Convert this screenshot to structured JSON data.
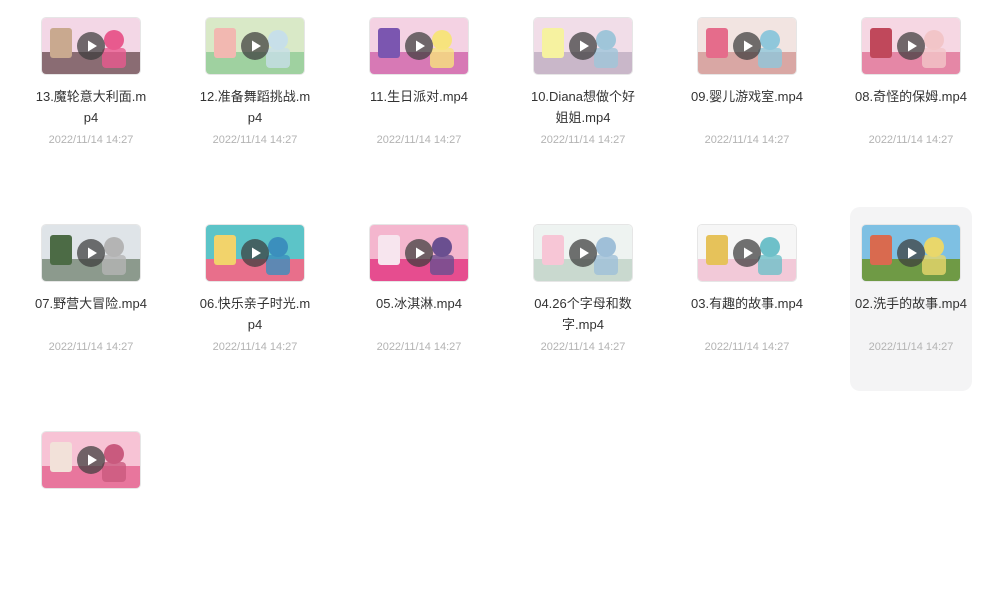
{
  "files": [
    {
      "name": "13.魔轮意大利面.mp4",
      "date": "2022/11/14 14:27",
      "selected": false,
      "colors": [
        "#f3d7e6",
        "#8a6c73",
        "#c9a98f",
        "#e85a8e"
      ]
    },
    {
      "name": "12.准备舞蹈挑战.mp4",
      "date": "2022/11/14 14:27",
      "selected": false,
      "colors": [
        "#d9e9c7",
        "#9fd1a0",
        "#f2b8b1",
        "#c7dfe9"
      ]
    },
    {
      "name": "11.生日派对.mp4",
      "date": "2022/11/14 14:27",
      "selected": false,
      "colors": [
        "#f4d2e3",
        "#d779b5",
        "#7b56b0",
        "#f7e37d"
      ]
    },
    {
      "name": "10.Diana想做个好姐姐.mp4",
      "date": "2022/11/14 14:27",
      "selected": false,
      "colors": [
        "#f1dde8",
        "#c9b7c9",
        "#f6f2a0",
        "#9fc5d9"
      ]
    },
    {
      "name": "09.婴儿游戏室.mp4",
      "date": "2022/11/14 14:27",
      "selected": false,
      "colors": [
        "#f2e4e1",
        "#d9a7a4",
        "#e56c8b",
        "#8fc7db"
      ]
    },
    {
      "name": "08.奇怪的保姆.mp4",
      "date": "2022/11/14 14:27",
      "selected": false,
      "colors": [
        "#f6d7e3",
        "#e587a6",
        "#c0485b",
        "#f2c5c8"
      ]
    },
    {
      "name": "07.野营大冒险.mp4",
      "date": "2022/11/14 14:27",
      "selected": false,
      "colors": [
        "#dfe4e8",
        "#8c9a8d",
        "#4c6b45",
        "#b4b4b4"
      ]
    },
    {
      "name": "06.快乐亲子时光.mp4",
      "date": "2022/11/14 14:27",
      "selected": false,
      "colors": [
        "#5cc4c8",
        "#e86f8b",
        "#f2d36b",
        "#3b8fbd"
      ]
    },
    {
      "name": "05.冰淇淋.mp4",
      "date": "2022/11/14 14:27",
      "selected": false,
      "colors": [
        "#f4b6ce",
        "#e64d8f",
        "#f7e5ee",
        "#6a4f90"
      ]
    },
    {
      "name": "04.26个字母和数字.mp4",
      "date": "2022/11/14 14:27",
      "selected": false,
      "colors": [
        "#eef3f1",
        "#c9d9cf",
        "#f7c6d6",
        "#9fbfd8"
      ]
    },
    {
      "name": "03.有趣的故事.mp4",
      "date": "2022/11/14 14:27",
      "selected": false,
      "colors": [
        "#f6f6f6",
        "#f2c9d8",
        "#e6c25a",
        "#6ec0c9"
      ]
    },
    {
      "name": "02.洗手的故事.mp4",
      "date": "2022/11/14 14:27",
      "selected": true,
      "colors": [
        "#7ec0e3",
        "#6f9a45",
        "#d96a4f",
        "#e9d76b"
      ]
    },
    {
      "name": "",
      "date": "",
      "selected": false,
      "colors": [
        "#f7c3d5",
        "#e8769d",
        "#f2e1d9",
        "#c95a7e"
      ]
    }
  ],
  "icons": {
    "play": "play-icon"
  }
}
